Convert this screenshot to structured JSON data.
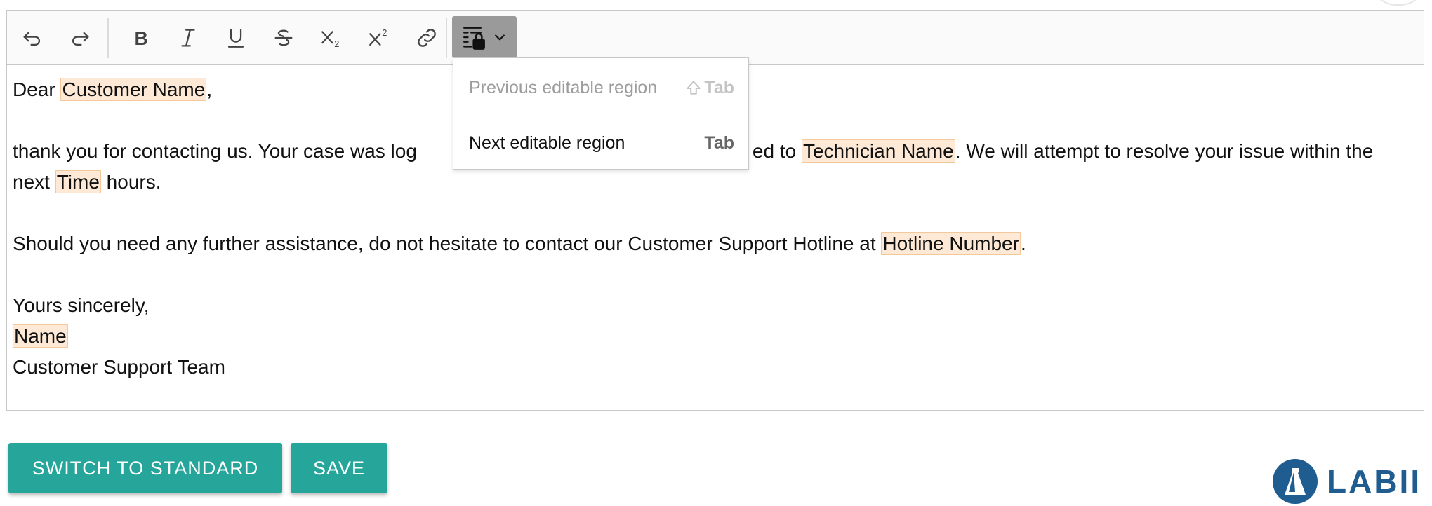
{
  "toolbar": {
    "buttons": [
      {
        "name": "undo-button",
        "icon": "undo-icon"
      },
      {
        "name": "redo-button",
        "icon": "redo-icon"
      },
      {
        "name": "bold-button",
        "icon": "bold-icon"
      },
      {
        "name": "italic-button",
        "icon": "italic-icon"
      },
      {
        "name": "underline-button",
        "icon": "underline-icon"
      },
      {
        "name": "strikethrough-button",
        "icon": "strikethrough-icon"
      },
      {
        "name": "subscript-button",
        "icon": "subscript-icon"
      },
      {
        "name": "superscript-button",
        "icon": "superscript-icon"
      },
      {
        "name": "link-button",
        "icon": "link-icon"
      }
    ],
    "restricted_editing": {
      "icon": "restricted-editing-lock-icon",
      "dropdown_icon": "chevron-down-icon",
      "active": true
    }
  },
  "menu": {
    "prev_label": "Previous editable region",
    "prev_key": "Tab",
    "prev_key_icon": "shift-icon",
    "next_label": "Next editable region",
    "next_key": "Tab"
  },
  "content": {
    "p1_dear": "Dear ",
    "p1_field": "Customer Name",
    "p1_end": ",",
    "p2_start": "thank you for contacting us. Your case was log",
    "p2_mid": "ed to ",
    "p2_field_tech": "Technician Name",
    "p2_after_tech": ". We will attempt to resolve your issue within the",
    "p2_next": "next ",
    "p2_field_time": "Time",
    "p2_end": " hours.",
    "p3_start": "Should you need any further assistance, do not hesitate to contact our Customer Support Hotline at ",
    "p3_field": "Hotline Number",
    "p3_end": ".",
    "sign_yours": "Yours sincerely,",
    "sign_field_name": "Name",
    "sign_team": "Customer Support Team"
  },
  "buttons": {
    "switch_label": "SWITCH TO STANDARD",
    "save_label": "SAVE"
  },
  "logo": {
    "text": "LABII"
  },
  "colors": {
    "accent": "#26a69a",
    "field_bg": "#fde9d6",
    "field_border": "#f3c89a",
    "logo_blue": "#1f5c8f"
  }
}
